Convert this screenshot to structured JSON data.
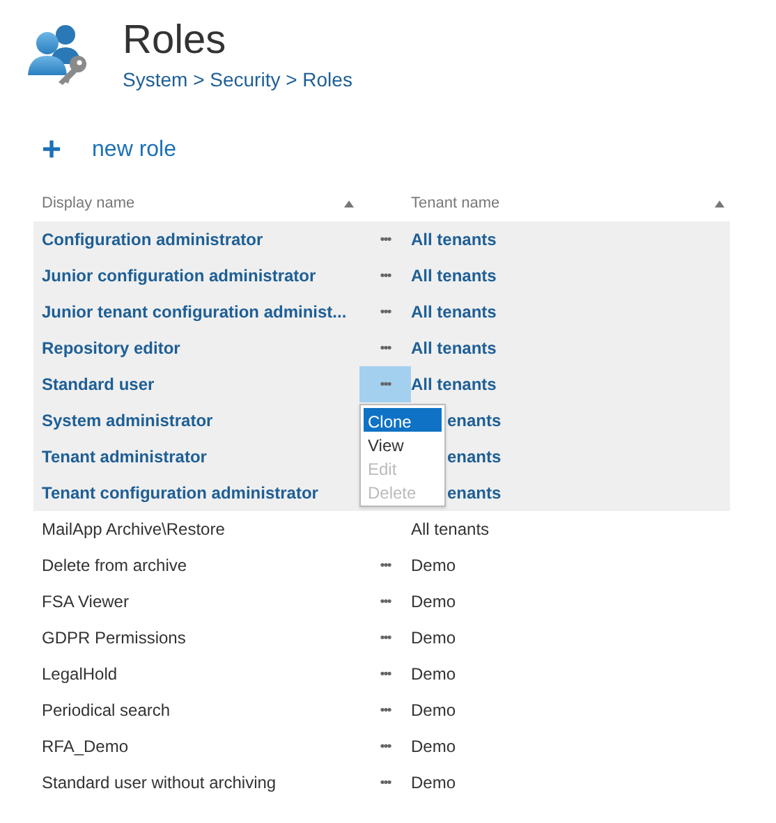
{
  "header": {
    "title": "Roles",
    "breadcrumb": "System > Security > Roles"
  },
  "new_button": {
    "icon": "+",
    "label": "new role"
  },
  "table": {
    "columns": [
      {
        "label": "Display name",
        "sorted": true
      },
      {
        "label": "Tenant name",
        "sorted": true
      }
    ],
    "rows": [
      {
        "kind": "builtin",
        "name": "Configuration administrator",
        "actions": "•••",
        "tenant": "All tenants",
        "menu_open": false
      },
      {
        "kind": "builtin",
        "name": "Junior configuration administrator",
        "actions": "•••",
        "tenant": "All tenants",
        "menu_open": false
      },
      {
        "kind": "builtin",
        "name": "Junior tenant configuration administ...",
        "actions": "•••",
        "tenant": "All tenants",
        "menu_open": false
      },
      {
        "kind": "builtin",
        "name": "Repository editor",
        "actions": "•••",
        "tenant": "All tenants",
        "menu_open": false
      },
      {
        "kind": "builtin",
        "name": "Standard user",
        "actions": "•••",
        "tenant": "All tenants",
        "menu_open": true
      },
      {
        "kind": "builtin",
        "name": "System administrator",
        "tenant": "enants",
        "menu_open": false
      },
      {
        "kind": "builtin",
        "name": "Tenant administrator",
        "tenant": "enants",
        "menu_open": false
      },
      {
        "kind": "builtin",
        "name": "Tenant configuration administrator",
        "tenant": "enants",
        "menu_open": false
      },
      {
        "kind": "custom",
        "name": "MailApp Archive\\Restore",
        "tenant": "All tenants",
        "menu_open": false
      },
      {
        "kind": "custom",
        "name": "Delete from archive",
        "actions": "•••",
        "tenant": "Demo",
        "menu_open": false
      },
      {
        "kind": "custom",
        "name": "FSA Viewer",
        "actions": "•••",
        "tenant": "Demo",
        "menu_open": false
      },
      {
        "kind": "custom",
        "name": "GDPR Permissions",
        "actions": "•••",
        "tenant": "Demo",
        "menu_open": false
      },
      {
        "kind": "custom",
        "name": "LegalHold",
        "actions": "•••",
        "tenant": "Demo",
        "menu_open": false
      },
      {
        "kind": "custom",
        "name": "Periodical search",
        "actions": "•••",
        "tenant": "Demo",
        "menu_open": false
      },
      {
        "kind": "custom",
        "name": "RFA_Demo",
        "actions": "•••",
        "tenant": "Demo",
        "menu_open": false
      },
      {
        "kind": "custom",
        "name": "Standard user without archiving",
        "actions": "•••",
        "tenant": "Demo",
        "menu_open": false
      }
    ]
  },
  "context_menu": {
    "items": [
      {
        "label": "Clone",
        "selected": true,
        "disabled": false
      },
      {
        "label": "View",
        "selected": false,
        "disabled": false
      },
      {
        "label": "Edit",
        "selected": false,
        "disabled": true
      },
      {
        "label": "Delete",
        "selected": false,
        "disabled": true
      }
    ]
  }
}
